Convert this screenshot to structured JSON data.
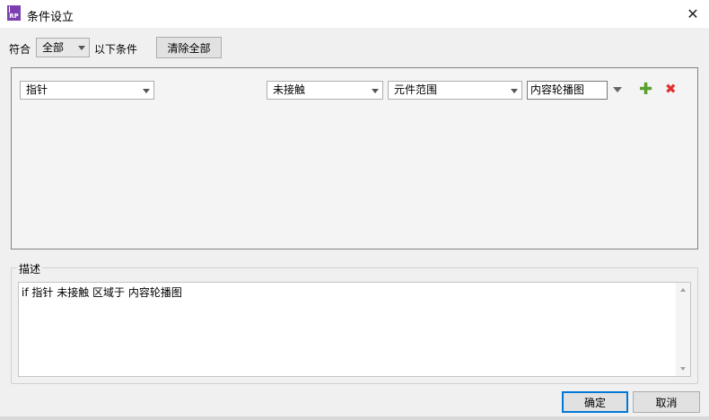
{
  "window": {
    "title": "条件设立",
    "icon_text": "RP"
  },
  "header": {
    "match_label": "符合",
    "match_value": "全部",
    "suffix_label": "以下条件",
    "clear_all_label": "清除全部"
  },
  "condition": {
    "subject": "指针",
    "operator": "未接触",
    "target_type": "元件范围",
    "target_value": "内容轮播图"
  },
  "description": {
    "legend": "描述",
    "text": "if 指针 未接触 区域于 内容轮播图"
  },
  "footer": {
    "ok_label": "确定",
    "cancel_label": "取消"
  },
  "icons": {
    "add": "plus-icon",
    "remove": "remove-icon",
    "close": "close-icon"
  },
  "colors": {
    "add_icon": "#5aa02c",
    "remove_icon": "#e03030",
    "primary_border": "#0078d7",
    "app_icon": "#7b3fb0"
  }
}
